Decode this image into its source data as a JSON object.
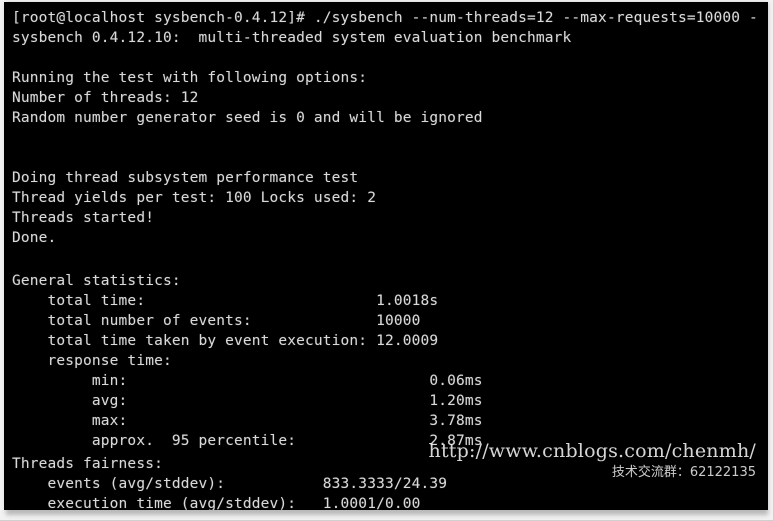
{
  "terminal": {
    "background_color": "#000000",
    "text_color": "#d9d9d9",
    "prompt": "[root@localhost sysbench-0.4.12]# ",
    "command": "./sysbench --num-threads=12 --max-requests=10000 -",
    "lines": [
      {
        "id": "prompt-line",
        "text": "[root@localhost sysbench-0.4.12]# ./sysbench --num-threads=12 --max-requests=10000 -"
      },
      {
        "id": "version-banner",
        "text": "sysbench 0.4.12.10:  multi-threaded system evaluation benchmark"
      },
      {
        "id": "blank-1",
        "text": ""
      },
      {
        "id": "running-options",
        "text": "Running the test with following options:"
      },
      {
        "id": "number-of-threads",
        "text": "Number of threads: 12"
      },
      {
        "id": "random-seed",
        "text": "Random number generator seed is 0 and will be ignored"
      },
      {
        "id": "blank-2",
        "text": ""
      },
      {
        "id": "blank-3",
        "text": ""
      },
      {
        "id": "doing-thread-test",
        "text": "Doing thread subsystem performance test"
      },
      {
        "id": "thread-yields",
        "text": "Thread yields per test: 100 Locks used: 2"
      },
      {
        "id": "threads-started",
        "text": "Threads started!"
      },
      {
        "id": "done",
        "text": "Done."
      },
      {
        "id": "blank-4",
        "text": ""
      },
      {
        "id": "blank-5",
        "text": ""
      },
      {
        "id": "general-statistics",
        "text": "General statistics:"
      },
      {
        "id": "total-time",
        "text": "    total time:                          1.0018s"
      },
      {
        "id": "total-events",
        "text": "    total number of events:              10000"
      },
      {
        "id": "total-exec-time",
        "text": "    total time taken by event execution: 12.0009"
      },
      {
        "id": "response-time",
        "text": "    response time:"
      },
      {
        "id": "rt-min",
        "text": "         min:                                  0.06ms"
      },
      {
        "id": "rt-avg",
        "text": "         avg:                                  1.20ms"
      },
      {
        "id": "rt-max",
        "text": "         max:                                  3.78ms"
      },
      {
        "id": "rt-95pct",
        "text": "         approx.  95 percentile:               2.87ms"
      },
      {
        "id": "blank-6",
        "text": ""
      },
      {
        "id": "threads-fairness",
        "text": "Threads fairness:"
      },
      {
        "id": "fairness-events",
        "text": "    events (avg/stddev):           833.3333/24.39"
      },
      {
        "id": "fairness-exec-time",
        "text": "    execution time (avg/stddev):   1.0001/0.00"
      }
    ]
  },
  "statistics": {
    "general": {
      "total_time": "1.0018s",
      "total_number_of_events": "10000",
      "total_time_taken_by_event_execution": "12.0009",
      "response_time": {
        "min": "0.06ms",
        "avg": "1.20ms",
        "max": "3.78ms",
        "approx_95_percentile": "2.87ms"
      }
    },
    "threads_fairness": {
      "events_avg_stddev": "833.3333/24.39",
      "execution_time_avg_stddev": "1.0001/0.00"
    }
  },
  "options": {
    "num_threads": "12",
    "max_requests": "10000",
    "thread_yields_per_test": "100",
    "locks_used": "2",
    "random_seed": "0"
  },
  "watermark": {
    "url": "http://www.cnblogs.com/chenmh/",
    "subtitle": "技术交流群：62122135"
  }
}
